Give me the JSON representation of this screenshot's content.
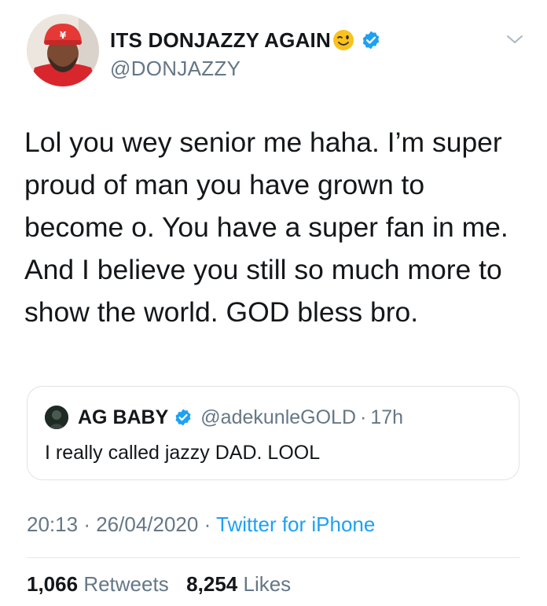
{
  "author": {
    "display_name": "ITS DONJAZZY AGAIN",
    "handle": "@DONJAZZY",
    "avatar_icon": "avatar-photo",
    "emoji": "winking-face-emoji",
    "verified_icon": "verified-badge-icon"
  },
  "tweet": {
    "lines": [
      "Lol you wey senior me haha. I’m super",
      "proud of man you have grown to",
      "become o. You have a super fan in me.",
      "And I believe you still so much more to",
      "show the world. GOD bless bro."
    ]
  },
  "quoted_tweet": {
    "display_name": "AG BABY",
    "handle": "@adekunleGOLD",
    "separator": "·",
    "time": "17h",
    "text": "I really called jazzy DAD. LOOL"
  },
  "meta": {
    "time": "20:13",
    "separator1": "·",
    "date": "26/04/2020",
    "separator2": "·",
    "source": "Twitter for iPhone"
  },
  "stats": {
    "retweets_count": "1,066",
    "retweets_label": "Retweets",
    "likes_count": "8,254",
    "likes_label": "Likes"
  },
  "colors": {
    "accent": "#1da1f2",
    "secondary_text": "#657786",
    "primary_text": "#14171a",
    "border": "#dfe3e8"
  }
}
